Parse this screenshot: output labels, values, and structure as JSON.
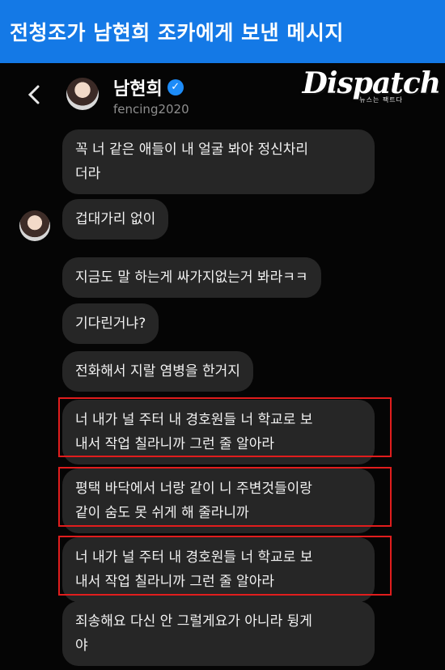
{
  "caption": "전청조가 남현희 조카에게 보낸 메시지",
  "header": {
    "name": "남현희",
    "handle": "fencing2020",
    "logo_text": "Dispatch",
    "logo_sub": "뉴스는 팩트다"
  },
  "messages": [
    "꼭 너 같은 애들이 내 얼굴 봐야 정신차리\n더라",
    "겁대가리 없이",
    "지금도 말 하는게 싸가지없는거 봐라ㅋㅋ",
    "기다린거냐?",
    "전화해서 지랄 염병을 한거지",
    "너 내가 널 주터 내 경호원들 너 학교로 보\n내서 작업 칠라니까 그런 줄 알아라",
    "평택 바닥에서 너랑 같이 니 주변것들이랑\n같이 숨도 못 쉬게 해 줄라니까",
    "너 내가 널 주터 내 경호원들 너 학교로 보\n내서 작업 칠라니까 그런 줄 알아라",
    "죄송해요 다신 안 그럴게요가 아니라 뒹게\n야"
  ]
}
